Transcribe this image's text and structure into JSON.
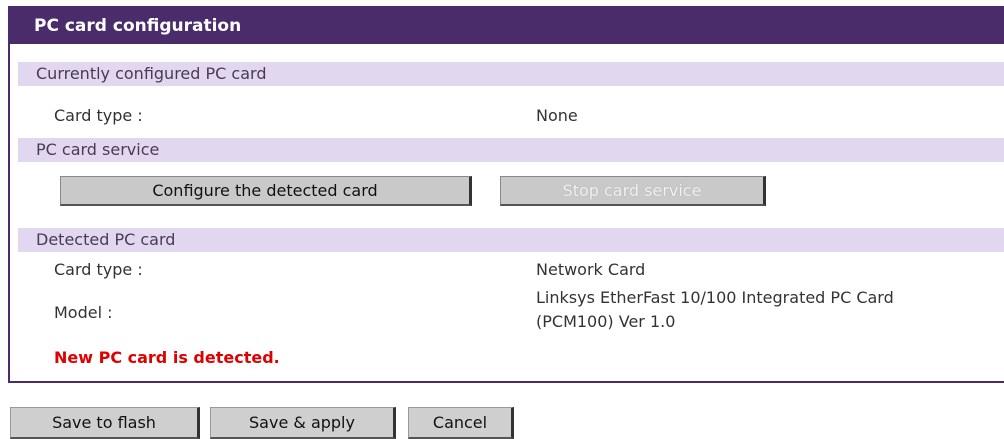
{
  "panel": {
    "title": "PC card configuration"
  },
  "current": {
    "section_title": "Currently configured PC card",
    "card_type_label": "Card type :",
    "card_type_value": "None"
  },
  "service": {
    "section_title": "PC card service",
    "configure_button": "Configure the detected card",
    "stop_button": "Stop card service"
  },
  "detected": {
    "section_title": "Detected PC card",
    "card_type_label": "Card type :",
    "card_type_value": "Network Card",
    "model_label": "Model :",
    "model_value_line1": "Linksys EtherFast 10/100 Integrated PC Card",
    "model_value_line2": "(PCM100) Ver 1.0",
    "message": "New PC card is detected."
  },
  "actions": {
    "save_flash": "Save to flash",
    "save_apply": "Save & apply",
    "cancel": "Cancel"
  },
  "colors": {
    "header_bg": "#4a2c6a",
    "section_bg": "#e1d7ee",
    "alert_text": "#e00000"
  }
}
